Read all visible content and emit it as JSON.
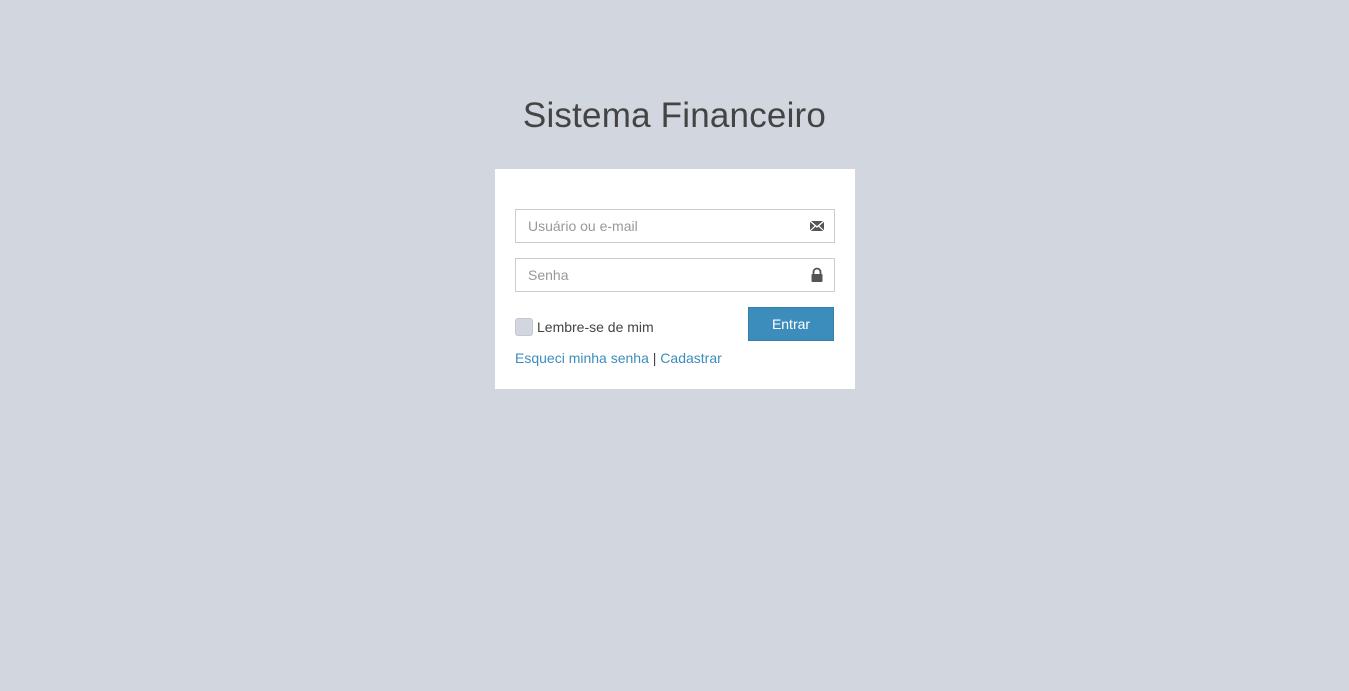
{
  "header": {
    "title": "Sistema Financeiro"
  },
  "form": {
    "username": {
      "placeholder": "Usuário ou e-mail",
      "value": "",
      "icon": "envelope-icon"
    },
    "password": {
      "placeholder": "Senha",
      "value": "",
      "icon": "lock-icon"
    },
    "remember": {
      "label": "Lembre-se de mim",
      "checked": false
    },
    "submit_label": "Entrar"
  },
  "links": {
    "forgot_password": "Esqueci minha senha",
    "separator": "|",
    "register": "Cadastrar"
  },
  "colors": {
    "background": "#d2d6de",
    "primary": "#3c8dbc",
    "panel": "#ffffff"
  }
}
